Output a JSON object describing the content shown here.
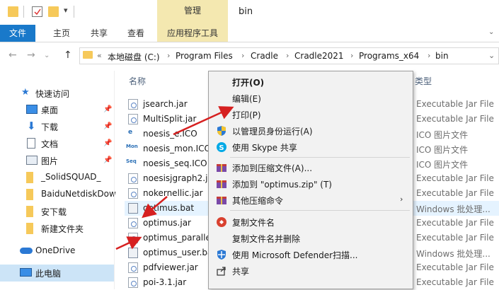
{
  "window": {
    "title": "bin"
  },
  "ribbon": {
    "contextual_group": "管理",
    "tabs": [
      {
        "label": "文件"
      },
      {
        "label": "主页"
      },
      {
        "label": "共享"
      },
      {
        "label": "查看"
      },
      {
        "label": "应用程序工具"
      }
    ]
  },
  "address": {
    "crumbs": [
      "本地磁盘 (C:)",
      "Program Files",
      "Cradle",
      "Cradle2021",
      "Programs_x64",
      "bin"
    ],
    "overflow": "«"
  },
  "nav_pane": {
    "items": [
      {
        "label": "快速访问",
        "icon": "star-icon"
      },
      {
        "label": "桌面",
        "icon": "desktop-icon",
        "pinned": true
      },
      {
        "label": "下载",
        "icon": "download-icon",
        "pinned": true
      },
      {
        "label": "文档",
        "icon": "document-icon",
        "pinned": true
      },
      {
        "label": "图片",
        "icon": "picture-icon",
        "pinned": true
      },
      {
        "label": "_SolidSQUAD_",
        "icon": "folder-icon"
      },
      {
        "label": "BaiduNetdiskDow",
        "icon": "folder-icon"
      },
      {
        "label": "安下载",
        "icon": "folder-icon"
      },
      {
        "label": "新建文件夹",
        "icon": "folder-icon"
      },
      {
        "label": "OneDrive",
        "icon": "cloud-icon"
      },
      {
        "label": "此电脑",
        "icon": "computer-icon"
      }
    ]
  },
  "file_list": {
    "columns": {
      "name": "名称",
      "type": "类型"
    },
    "rows": [
      {
        "name": "jsearch.jar",
        "type": "Executable Jar File",
        "icon": "jar"
      },
      {
        "name": "MultiSplit.jar",
        "type": "Executable Jar File",
        "icon": "jar"
      },
      {
        "name": "noesis_e.ICO",
        "type": "ICO 图片文件",
        "icon": "ico"
      },
      {
        "name": "noesis_mon.ICO",
        "type": "ICO 图片文件",
        "icon": "ico"
      },
      {
        "name": "noesis_seq.ICO",
        "type": "ICO 图片文件",
        "icon": "ico"
      },
      {
        "name": "noesisjgraph2.jar",
        "type": "Executable Jar File",
        "icon": "jar"
      },
      {
        "name": "nokernellic.jar",
        "type": "Executable Jar File",
        "icon": "jar"
      },
      {
        "name": "optimus.bat",
        "type": "Windows 批处理...",
        "icon": "bat"
      },
      {
        "name": "optimus.jar",
        "type": "Executable Jar File",
        "icon": "jar"
      },
      {
        "name": "optimus_paralle",
        "type": "Executable Jar File",
        "icon": "jar"
      },
      {
        "name": "optimus_user.ba",
        "type": "Windows 批处理...",
        "icon": "bat"
      },
      {
        "name": "pdfviewer.jar",
        "type": "Executable Jar File",
        "icon": "jar"
      },
      {
        "name": "poi-3.1.jar",
        "type": "Executable Jar File",
        "icon": "jar"
      }
    ]
  },
  "context_menu": {
    "items": [
      {
        "label": "打开(O)",
        "bold": true
      },
      {
        "label": "编辑(E)"
      },
      {
        "label": "打印(P)"
      },
      {
        "label": "以管理员身份运行(A)",
        "icon": "shield-icon"
      },
      {
        "label": "使用 Skype 共享",
        "icon": "skype-icon"
      },
      {
        "label": "添加到压缩文件(A)...",
        "icon": "archive-icon"
      },
      {
        "label": "添加到 \"optimus.zip\" (T)",
        "icon": "archive-icon"
      },
      {
        "label": "其他压缩命令",
        "icon": "archive-icon",
        "submenu": true
      },
      {
        "label": "复制文件名",
        "icon": "copy-name-icon"
      },
      {
        "label": "复制文件名并删除"
      },
      {
        "label": "使用 Microsoft Defender扫描...",
        "icon": "defender-icon"
      },
      {
        "label": "共享",
        "icon": "share-icon"
      }
    ]
  },
  "colors": {
    "accent": "#1979ca",
    "contextual_tab": "#f4e8b0",
    "arrow": "#d62020"
  }
}
